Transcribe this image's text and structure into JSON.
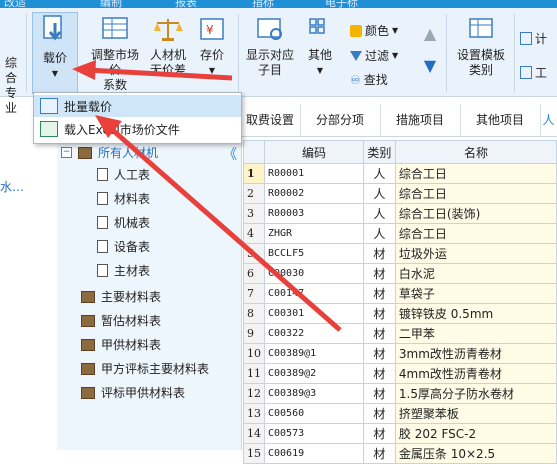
{
  "topstrip": {
    "left_title": "改适",
    "tab1": "编制",
    "tab2": "报表",
    "tab3": "指标",
    "tab4": "电子标"
  },
  "ribbon": {
    "left_top": "综合",
    "left_bottom": "专业",
    "zaijia": "载价",
    "tiaozheng_top": "调整市场价",
    "tiaozheng_bottom": "系数",
    "rencaiji_top": "人材机",
    "rencaiji_bottom": "无价差",
    "cunjia": "存价",
    "xianshi_top": "显示对应",
    "xianshi_bottom": "子目",
    "other": "其他",
    "color": "颜色",
    "filter": "过滤",
    "find": "查找",
    "template_top": "设置模板",
    "template_bottom": "类别",
    "calc": "计",
    "tools": "工"
  },
  "dropdown": {
    "item1": "批量载价",
    "item2": "载入Excel市场价文件"
  },
  "tabs2": {
    "fee": "取费设置",
    "fbfx": "分部分项",
    "csxm": "措施项目",
    "qtxm": "其他项目",
    "rcj": "人"
  },
  "leftpane": {
    "partial": "水…"
  },
  "tree": {
    "root": "所有人材机",
    "collapse": "《",
    "children": [
      "人工表",
      "材料表",
      "机械表",
      "设备表",
      "主材表"
    ],
    "groups": [
      "主要材料表",
      "暂估材料表",
      "甲供材料表",
      "甲方评标主要材料表",
      "评标甲供材料表"
    ]
  },
  "grid": {
    "headers": {
      "num": "",
      "code": "编码",
      "cat": "类别",
      "name": "名称"
    },
    "rows": [
      {
        "n": "1",
        "code": "R00001",
        "cat": "人",
        "name": "综合工日"
      },
      {
        "n": "2",
        "code": "R00002",
        "cat": "人",
        "name": "综合工日"
      },
      {
        "n": "3",
        "code": "R00003",
        "cat": "人",
        "name": "综合工日(装饰)"
      },
      {
        "n": "4",
        "code": "ZHGR",
        "cat": "人",
        "name": "综合工日"
      },
      {
        "n": "5",
        "code": "BCCLF5",
        "cat": "材",
        "name": "垃圾外运"
      },
      {
        "n": "6",
        "code": "C00030",
        "cat": "材",
        "name": "白水泥"
      },
      {
        "n": "7",
        "code": "C00147",
        "cat": "材",
        "name": "草袋子"
      },
      {
        "n": "8",
        "code": "C00301",
        "cat": "材",
        "name": "镀锌铁皮 0.5mm"
      },
      {
        "n": "9",
        "code": "C00322",
        "cat": "材",
        "name": "二甲苯"
      },
      {
        "n": "10",
        "code": "C00389@1",
        "cat": "材",
        "name": "3mm改性沥青卷材"
      },
      {
        "n": "11",
        "code": "C00389@2",
        "cat": "材",
        "name": "4mm改性沥青卷材"
      },
      {
        "n": "12",
        "code": "C00389@3",
        "cat": "材",
        "name": "1.5厚高分子防水卷材"
      },
      {
        "n": "13",
        "code": "C00560",
        "cat": "材",
        "name": "挤塑聚苯板"
      },
      {
        "n": "14",
        "code": "C00573",
        "cat": "材",
        "name": "胶 202 FSC-2"
      },
      {
        "n": "15",
        "code": "C00619",
        "cat": "材",
        "name": "金属压条 10×2.5"
      }
    ]
  },
  "colors": {
    "accent": "#1f8fd6",
    "arrow": "#e8413c",
    "ribbon_bg": "#eaf3fb",
    "tree_bg": "#eef6fd"
  }
}
